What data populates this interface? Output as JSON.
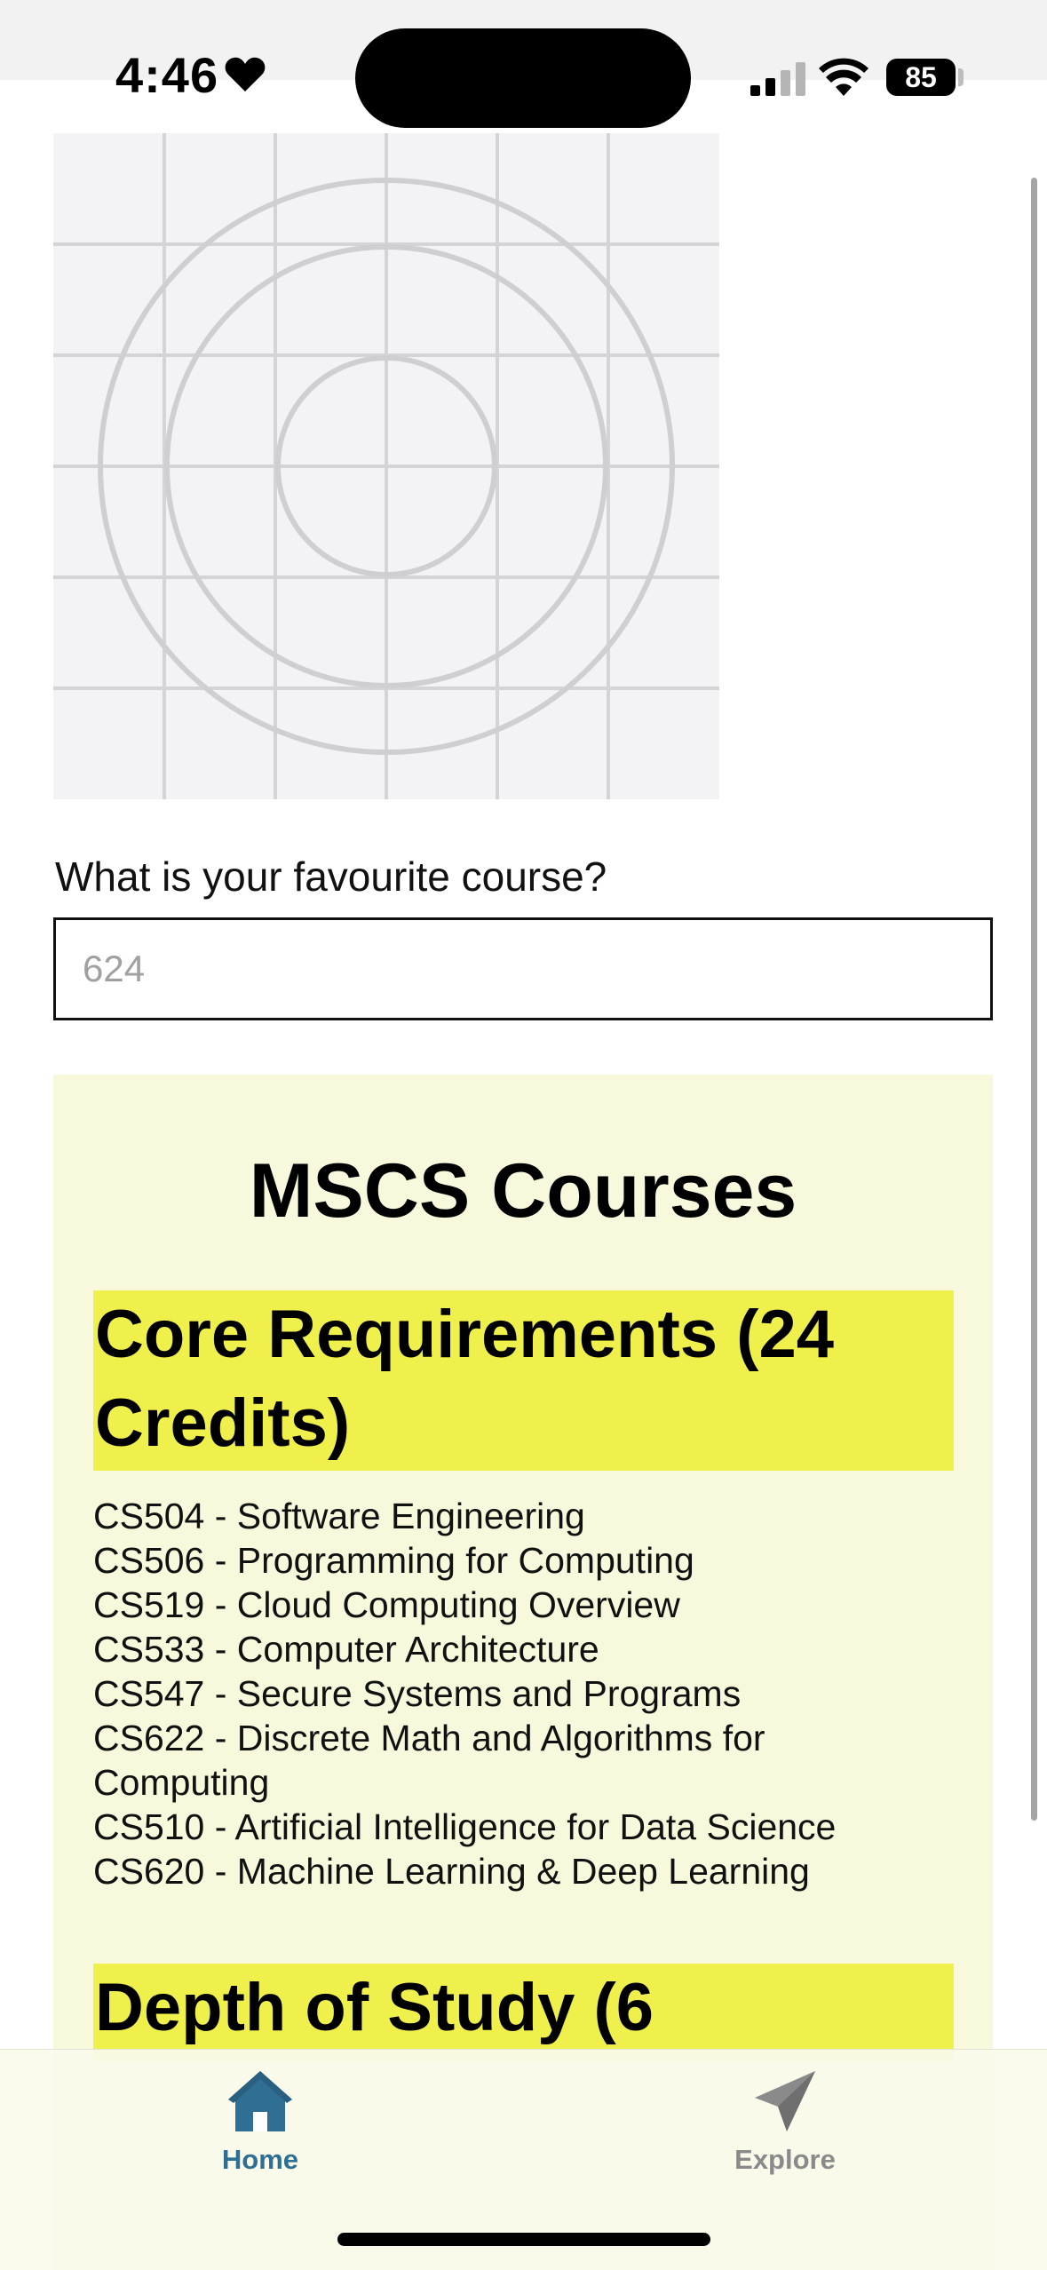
{
  "status_bar": {
    "time": "4:46",
    "battery_level": "85"
  },
  "form": {
    "question_label": "What is your favourite course?",
    "input_placeholder": "624",
    "input_value": ""
  },
  "courses": {
    "title": "MSCS Courses",
    "core_heading": "Core Requirements (24 Credits)",
    "core_courses": [
      "CS504 - Software Engineering",
      "CS506 - Programming for Computing",
      "CS519 - Cloud Computing Overview",
      "CS533 - Computer Architecture",
      "CS547 - Secure Systems and Programs",
      "CS622 - Discrete Math and Algorithms for Computing",
      "CS510 - Artificial Intelligence for Data Science",
      "CS620 - Machine Learning & Deep Learning"
    ],
    "depth_heading": "Depth of Study (6"
  },
  "tab_bar": {
    "tabs": [
      {
        "label": "Home",
        "icon": "house-icon",
        "active": true
      },
      {
        "label": "Explore",
        "icon": "paper-plane-icon",
        "active": false
      }
    ]
  },
  "colors": {
    "panel_background": "#f8f9dc",
    "heading_highlight": "#f0f04c",
    "active_tab": "#2f6f94",
    "inactive_tab": "#8a8a8a"
  }
}
